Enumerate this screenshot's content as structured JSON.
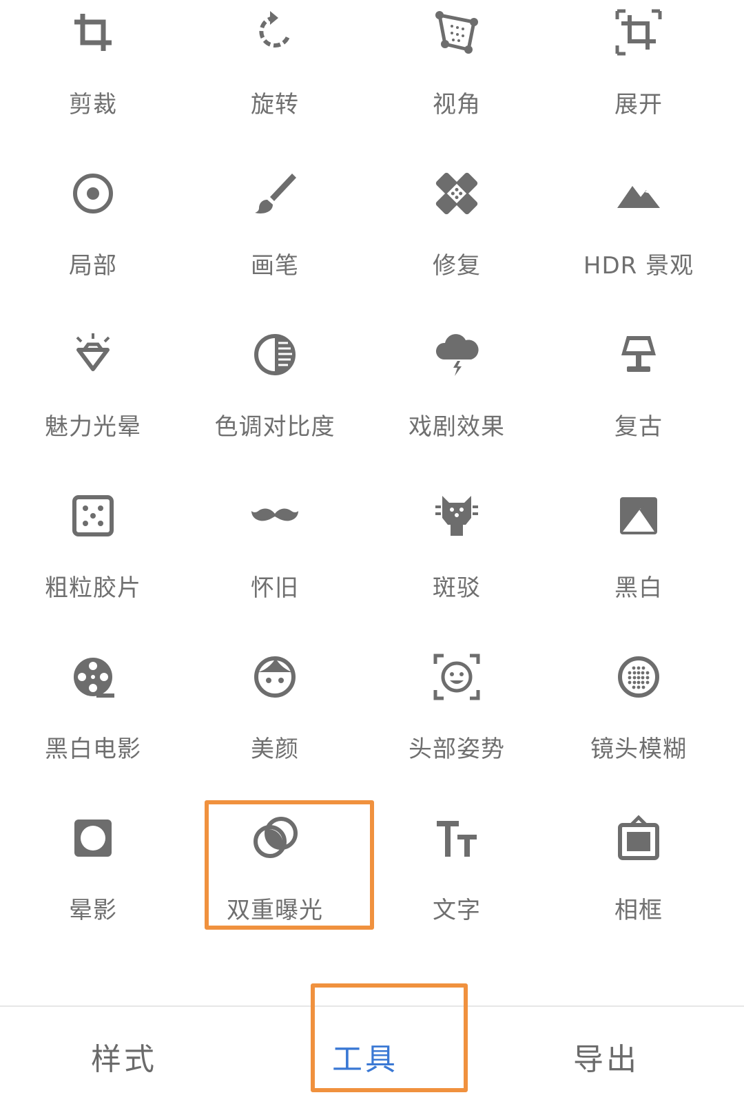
{
  "tools": [
    {
      "label": "剪裁",
      "icon": "crop-icon"
    },
    {
      "label": "旋转",
      "icon": "rotate-icon"
    },
    {
      "label": "视角",
      "icon": "perspective-icon"
    },
    {
      "label": "展开",
      "icon": "expand-icon"
    },
    {
      "label": "局部",
      "icon": "selective-icon"
    },
    {
      "label": "画笔",
      "icon": "brush-icon"
    },
    {
      "label": "修复",
      "icon": "healing-icon"
    },
    {
      "label": "HDR 景观",
      "icon": "hdr-mountain-icon"
    },
    {
      "label": "魅力光晕",
      "icon": "glamour-glow-icon"
    },
    {
      "label": "色调对比度",
      "icon": "tonal-contrast-icon"
    },
    {
      "label": "戏剧效果",
      "icon": "drama-icon"
    },
    {
      "label": "复古",
      "icon": "vintage-lamp-icon"
    },
    {
      "label": "粗粒胶片",
      "icon": "grainy-film-icon"
    },
    {
      "label": "怀旧",
      "icon": "retrolux-mustache-icon"
    },
    {
      "label": "斑驳",
      "icon": "grunge-icon"
    },
    {
      "label": "黑白",
      "icon": "black-white-icon"
    },
    {
      "label": "黑白电影",
      "icon": "noir-film-reel-icon"
    },
    {
      "label": "美颜",
      "icon": "portrait-face-icon"
    },
    {
      "label": "头部姿势",
      "icon": "head-pose-icon"
    },
    {
      "label": "镜头模糊",
      "icon": "lens-blur-icon"
    },
    {
      "label": "晕影",
      "icon": "vignette-icon"
    },
    {
      "label": "双重曝光",
      "icon": "double-exposure-icon"
    },
    {
      "label": "文字",
      "icon": "text-icon"
    },
    {
      "label": "相框",
      "icon": "frames-icon"
    }
  ],
  "highlighted_tool": "双重曝光",
  "bottom_nav": {
    "styles_label": "样式",
    "tools_label": "工具",
    "export_label": "导出",
    "active_tab": "工具"
  },
  "colors": {
    "icon": "#6d6d6d",
    "label": "#6f6f6f",
    "active_tab": "#3a78d4",
    "highlight_border": "#f0913e"
  }
}
